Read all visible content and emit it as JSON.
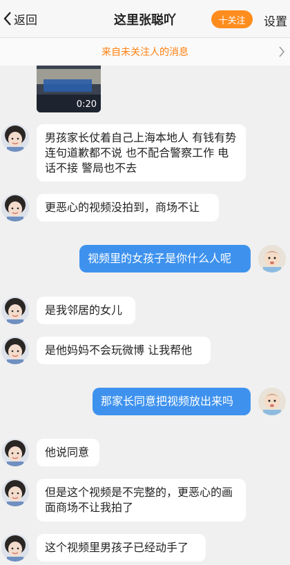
{
  "header": {
    "back_label": "返回",
    "title": "这里张聪吖",
    "follow_label": "十关注",
    "settings_label": "设置"
  },
  "notice": {
    "text": "来自未关注人的消息"
  },
  "video": {
    "duration": "0:20"
  },
  "messages": [
    {
      "side": "in",
      "text": "男孩家长仗着自己上海本地人 有钱有势连句道歉都不说 也不配合警察工作 电话不接 警局也不去"
    },
    {
      "side": "in",
      "text": "更恶心的视频没拍到，商场不让"
    },
    {
      "side": "out",
      "text": "视频里的女孩子是你什么人呢"
    },
    {
      "side": "in",
      "text": "是我邻居的女儿"
    },
    {
      "side": "in",
      "text": "是他妈妈不会玩微博 让我帮他"
    },
    {
      "side": "out",
      "text": "那家长同意把视频放出来吗"
    },
    {
      "side": "in",
      "text": "他说同意"
    },
    {
      "side": "in",
      "text": "但是这个视频是不完整的，更恶心的画面商场不让我拍了"
    },
    {
      "side": "in",
      "text": "这个视频里男孩子已经动手了"
    }
  ],
  "colors": {
    "accent": "#ff8d1e",
    "outgoing_bubble": "#3e92ee",
    "notice_text": "#ff7f0e"
  }
}
